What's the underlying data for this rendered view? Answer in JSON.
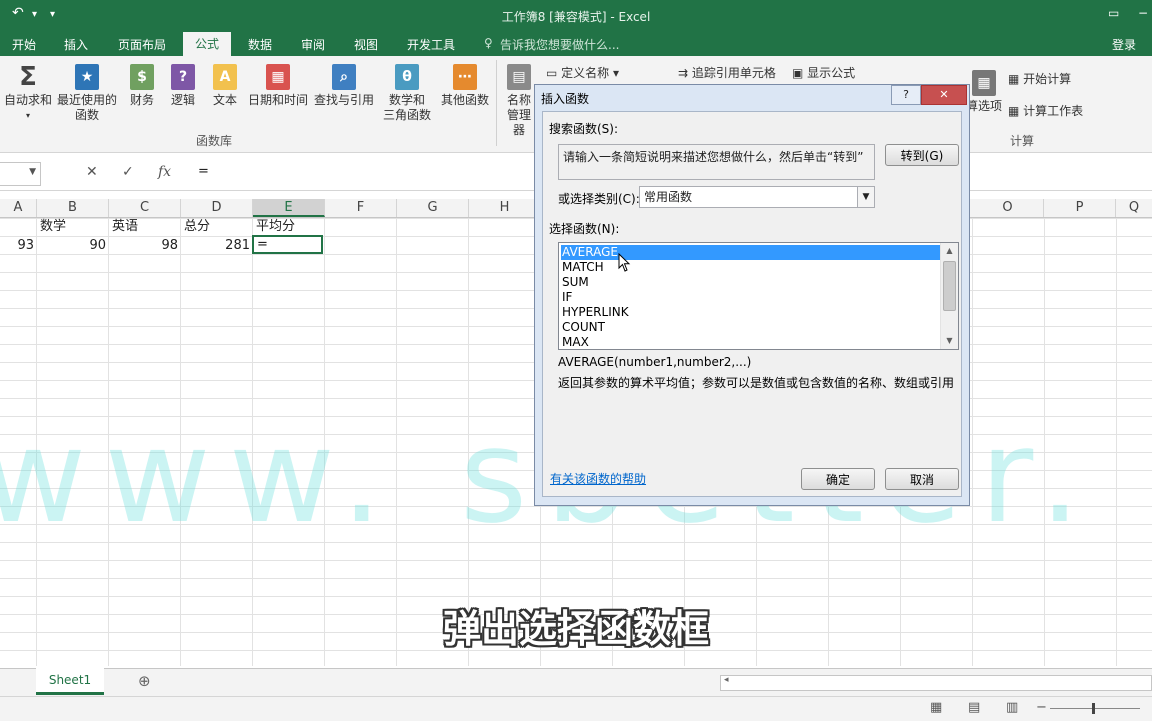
{
  "window": {
    "title": "工作簿8  [兼容模式] - Excel",
    "qa_undo": "↶",
    "qa_more": "▾",
    "minimize": "−",
    "restore": "▭"
  },
  "tabs": [
    "开始",
    "插入",
    "页面布局",
    "公式",
    "数据",
    "审阅",
    "视图",
    "开发工具"
  ],
  "active_tab": "公式",
  "tell_me": "告诉我您想要做什么...",
  "login": "登录",
  "ribbon": {
    "autosum": "自动求和",
    "recent_1": "最近使用的",
    "recent_2": "函数",
    "financial": "财务",
    "logical": "逻辑",
    "text": "文本",
    "datetime": "日期和时间",
    "lookup": "查找与引用",
    "math_1": "数学和",
    "math_2": "三角函数",
    "more": "其他函数",
    "name_1": "名称",
    "name_2": "管理器",
    "define_name": "定义名称",
    "trace": "追踪引用单元格",
    "show_formula": "显示公式",
    "calc_options": "算选项",
    "calc_now": "开始计算",
    "calc_sheet": "计算工作表",
    "group_library": "函数库",
    "group_calc": "计算"
  },
  "formula_bar": {
    "cancel": "✕",
    "enter": "✓",
    "fx": "fx",
    "content": "="
  },
  "columns": [
    "A",
    "B",
    "C",
    "D",
    "E",
    "F",
    "G",
    "H",
    "O",
    "P",
    "Q"
  ],
  "row1": {
    "b": "数学",
    "c": "英语",
    "d": "总分",
    "e": "平均分"
  },
  "row2": {
    "a": "93",
    "b": "90",
    "c": "98",
    "d": "281",
    "e": "="
  },
  "watermark": "www. sbetter. cn",
  "subtitle": "弹出选择函数框",
  "sheet": {
    "name": "Sheet1",
    "add": "⊕"
  },
  "dialog": {
    "title": "插入函数",
    "help_btn": "?",
    "close_btn": "✕",
    "search_label": "搜索函数(S):",
    "search_value": "请输入一条简短说明来描述您想做什么，然后单击“转到”",
    "goto": "转到(G)",
    "category_label": "或选择类别(C):",
    "category_value": "常用函数",
    "function_label": "选择函数(N):",
    "functions": [
      "AVERAGE",
      "MATCH",
      "SUM",
      "IF",
      "HYPERLINK",
      "COUNT",
      "MAX"
    ],
    "signature": "AVERAGE(number1,number2,...)",
    "description": "返回其参数的算术平均值；参数可以是数值或包含数值的名称、数组或引用",
    "help_link": "有关该函数的帮助",
    "ok": "确定",
    "cancel": "取消"
  },
  "colors": {
    "excel_green": "#217346",
    "selection": "#3399ff",
    "watermark": "#6de0dd"
  }
}
